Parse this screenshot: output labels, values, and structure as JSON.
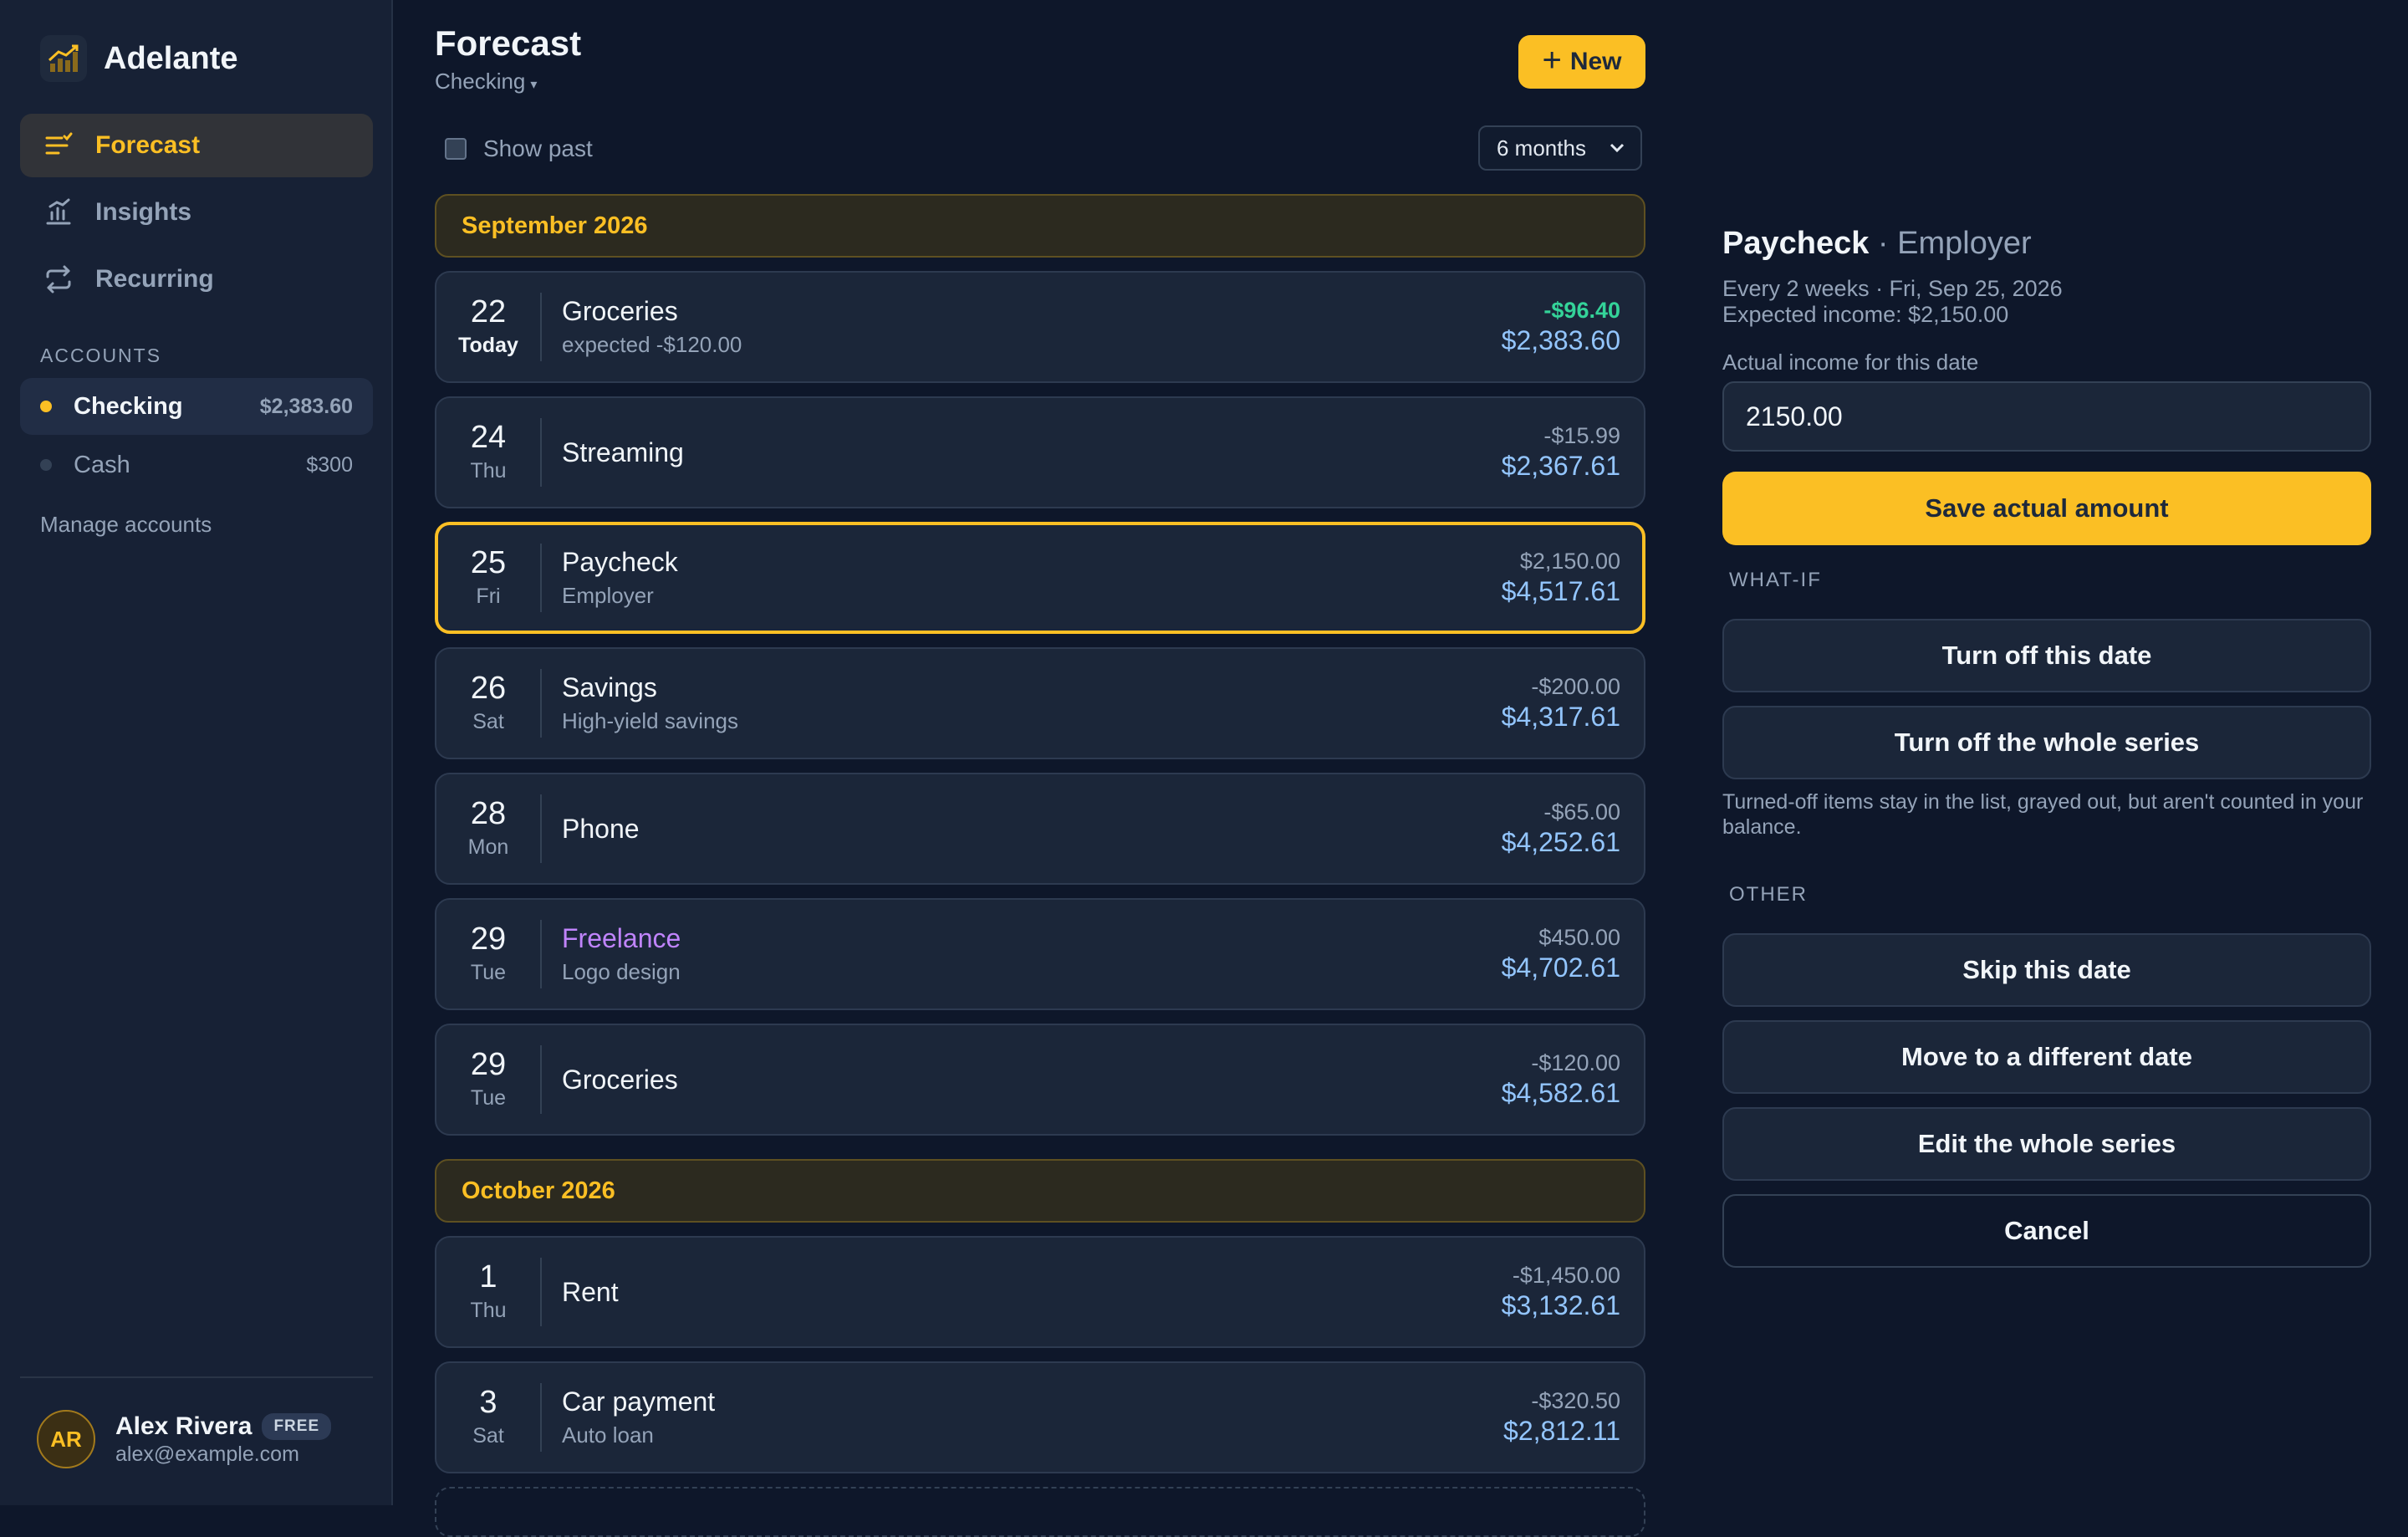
{
  "app": {
    "name": "Adelante"
  },
  "nav": [
    {
      "label": "Forecast",
      "icon": "forecast-icon",
      "active": true
    },
    {
      "label": "Insights",
      "icon": "insights-icon",
      "active": false
    },
    {
      "label": "Recurring",
      "icon": "recurring-icon",
      "active": false
    }
  ],
  "accounts": {
    "heading": "ACCOUNTS",
    "items": [
      {
        "name": "Checking",
        "balance": "$2,383.60",
        "color": "#fbbf24",
        "active": true
      },
      {
        "name": "Cash",
        "balance": "$300",
        "color": "#334155",
        "active": false
      }
    ],
    "manage_label": "Manage accounts"
  },
  "user": {
    "initials": "AR",
    "name": "Alex Rivera",
    "plan": "FREE",
    "email": "alex@example.com"
  },
  "main": {
    "title": "Forecast",
    "account_selector": "Checking",
    "new_button": "New",
    "show_past_label": "Show past",
    "show_past_checked": false,
    "range_selected": "6 months"
  },
  "months": [
    {
      "label": "September 2026",
      "rows": [
        {
          "day": "22",
          "weekday": "Today",
          "title": "Groceries",
          "subtitle": "expected -$120.00",
          "amount": "-$96.40",
          "balance": "$2,383.60",
          "amount_color": "green",
          "is_today": true
        },
        {
          "day": "24",
          "weekday": "Thu",
          "title": "Streaming",
          "subtitle": "",
          "amount": "-$15.99",
          "balance": "$2,367.61"
        },
        {
          "day": "25",
          "weekday": "Fri",
          "title": "Paycheck",
          "subtitle": "Employer",
          "amount": "$2,150.00",
          "balance": "$4,517.61",
          "selected": true
        },
        {
          "day": "26",
          "weekday": "Sat",
          "title": "Savings",
          "subtitle": "High-yield savings",
          "amount": "-$200.00",
          "balance": "$4,317.61"
        },
        {
          "day": "28",
          "weekday": "Mon",
          "title": "Phone",
          "subtitle": "",
          "amount": "-$65.00",
          "balance": "$4,252.61"
        },
        {
          "day": "29",
          "weekday": "Tue",
          "title": "Freelance",
          "subtitle": "Logo design",
          "amount": "$450.00",
          "balance": "$4,702.61",
          "title_color": "purple"
        },
        {
          "day": "29",
          "weekday": "Tue",
          "title": "Groceries",
          "subtitle": "",
          "amount": "-$120.00",
          "balance": "$4,582.61"
        }
      ]
    },
    {
      "label": "October 2026",
      "rows": [
        {
          "day": "1",
          "weekday": "Thu",
          "title": "Rent",
          "subtitle": "",
          "amount": "-$1,450.00",
          "balance": "$3,132.61"
        },
        {
          "day": "3",
          "weekday": "Sat",
          "title": "Car payment",
          "subtitle": "Auto loan",
          "amount": "-$320.50",
          "balance": "$2,812.11"
        }
      ]
    }
  ],
  "panel": {
    "title": "Paycheck",
    "separator": " · ",
    "subtitle": "Employer",
    "schedule": "Every 2 weeks · Fri, Sep 25, 2026",
    "expected": "Expected income: $2,150.00",
    "input_label": "Actual income for this date",
    "input_value": "2150.00",
    "save_label": "Save actual amount",
    "whatif_heading": "WHAT-IF",
    "turn_off_date": "Turn off this date",
    "turn_off_series": "Turn off the whole series",
    "turnoff_note": "Turned-off items stay in the list, grayed out, but aren't counted in your balance.",
    "other_heading": "OTHER",
    "skip_date": "Skip this date",
    "move_date": "Move to a different date",
    "edit_series": "Edit the whole series",
    "cancel": "Cancel"
  }
}
